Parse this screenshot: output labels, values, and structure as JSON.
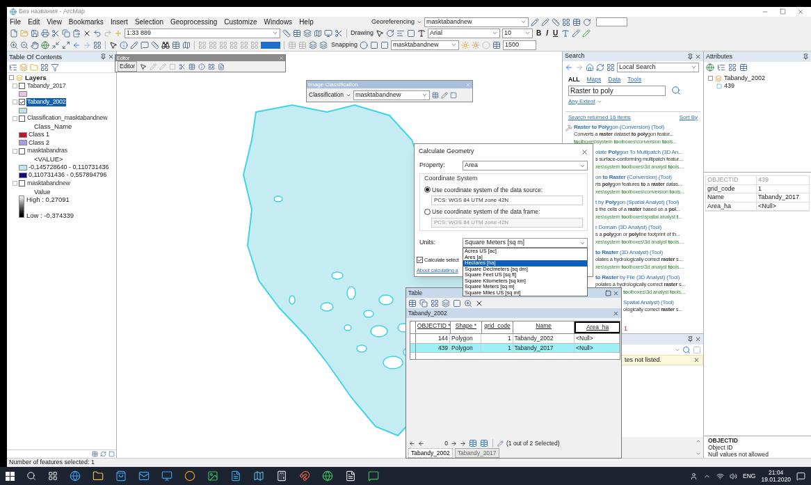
{
  "window": {
    "title": "Без названия - ArcMap"
  },
  "menu": [
    "File",
    "Edit",
    "View",
    "Bookmarks",
    "Insert",
    "Selection",
    "Geoprocessing",
    "Customize",
    "Windows",
    "Help"
  ],
  "toolbars": {
    "scale": "1:33 889",
    "drawing": "Drawing",
    "font": "Arial",
    "font_size": "10",
    "text_style": [
      "B",
      "I",
      "U"
    ],
    "georeferencing": "Georeferencing",
    "georef_layer": "masktabandnew",
    "snapping": "Snapping",
    "layer_combo": "masktabandnew",
    "reference_scale": "1500"
  },
  "editor_toolbar": {
    "title": "Editor",
    "menu": "Editor"
  },
  "image_classification": {
    "title": "Image Classification",
    "menu": "Classification",
    "layer": "masktabandnew"
  },
  "toc": {
    "title": "Table Of Contents",
    "root": "Layers",
    "layers": [
      {
        "name": "Tabandy_2017",
        "checked": false,
        "selected": false,
        "legend": [
          {
            "kind": "swatch",
            "color": "#e6c6ea"
          }
        ]
      },
      {
        "name": "Tabandy_2002",
        "checked": true,
        "selected": true,
        "legend": [
          {
            "kind": "swatch",
            "color": "#bfe2ea"
          }
        ]
      },
      {
        "name": "Classification_masktabandnew",
        "checked": false,
        "selected": false,
        "legend": [
          {
            "kind": "text",
            "label": "Class_Name"
          },
          {
            "kind": "swatch",
            "color": "#c0162c",
            "label": "Class 1"
          },
          {
            "kind": "swatch",
            "color": "#a89de6",
            "label": "Class 2"
          }
        ]
      },
      {
        "name": "masktabandras",
        "checked": false,
        "selected": false,
        "legend": [
          {
            "kind": "text",
            "label": "<VALUE>"
          },
          {
            "kind": "swatch",
            "color": "#c2e4ec",
            "label": "-0,145728640 - 0,110731436"
          },
          {
            "kind": "swatch",
            "color": "#0b0b80",
            "label": "0,110731436 - 0,557894796"
          }
        ]
      },
      {
        "name": "masktabandnew",
        "checked": false,
        "selected": false,
        "legend": [
          {
            "kind": "text",
            "label": "Value"
          },
          {
            "kind": "ramp",
            "high": "High : 0,27091",
            "low": "Low : -0,374339"
          }
        ]
      }
    ]
  },
  "dialog": {
    "title": "Calculate Geometry",
    "property_label": "Property:",
    "property": "Area",
    "group": "Coordinate System",
    "options": [
      {
        "label": "Use coordinate system of the data source:",
        "value": "PCS: WGS 84 UTM zone 42N",
        "selected": true
      },
      {
        "label": "Use coordinate system of the data frame:",
        "value": "PCS: WGS 84 UTM zone 42N",
        "selected": false
      }
    ],
    "units_label": "Units:",
    "units": "Square Meters [sq m]",
    "unit_options": [
      {
        "label": "Acres US [ac]",
        "selected": false
      },
      {
        "label": "Ares [a]",
        "selected": false
      },
      {
        "label": "Hectares [ha]",
        "selected": true
      },
      {
        "label": "Square Decimeters [sq dm]",
        "selected": false
      },
      {
        "label": "Square Feet US [sq ft]",
        "selected": false
      },
      {
        "label": "Square Kilometers [sq km]",
        "selected": false
      },
      {
        "label": "Square Meters [sq m]",
        "selected": false
      },
      {
        "label": "Square Miles US [sq mi]",
        "selected": false
      }
    ],
    "calc_selected": {
      "label": "Calculate select",
      "checked": true
    },
    "link": "About calculating a"
  },
  "table": {
    "title": "Table",
    "layer": "Tabandy_2002",
    "columns": [
      "OBJECTID *",
      "Shape *",
      "grid_code",
      "Name",
      "Area_ha"
    ],
    "rows": [
      {
        "cells": [
          "144",
          "Polygon",
          "1",
          "Tabandy_2002",
          "<Null>"
        ],
        "selected": false
      },
      {
        "cells": [
          "439",
          "Polygon",
          "1",
          "Tabandy_2017",
          "<Null>"
        ],
        "selected": true
      }
    ],
    "record": "0",
    "selection": "(1 out of 2 Selected)",
    "tabs": [
      {
        "label": "Tabandy_2002",
        "selected": true
      },
      {
        "label": "Tabandy_2017",
        "selected": false
      }
    ]
  },
  "search": {
    "title": "Search",
    "scope": "Local Search",
    "tabs": [
      {
        "label": "ALL",
        "selected": true
      },
      {
        "label": "Maps",
        "selected": false
      },
      {
        "label": "Data",
        "selected": false
      },
      {
        "label": "Tools",
        "selected": false
      }
    ],
    "query": "Raster to poly",
    "extent": "Any Extent",
    "summary": "Search returned 16 items",
    "sort": "Sort By",
    "results": [
      {
        "kind": "full",
        "title": "**Raster to Poly**gon (Conversion) (Tool)",
        "description": "Converts a **raster** dataset **to poly**gon featur...",
        "path": "**to**olboxes\\system **to**olboxes\\conversion **to**ols..."
      },
      {
        "kind": "clipped",
        "title": "olate **Poly**gon To Multipatch (3D An...",
        "description": "s surface-conforming multipatch featur...",
        "path": "xes\\system **to**olboxes\\3d analyst **to**ols...."
      },
      {
        "kind": "clipped",
        "title": "on **to Raster** (Conversion) (Tool)",
        "description": "rts **poly**gon features **to** a **raster** datas...",
        "path": "xes\\system **to**olboxes\\conversion **to**ols..."
      },
      {
        "kind": "clipped",
        "title": "t by **Poly**gon (Spatial Analyst) (Tool)",
        "description": "s the cells of a **raster** based on a **pol**...",
        "path": "xes\\system **to**olboxes\\spatial analyst **t**..."
      },
      {
        "kind": "clipped",
        "title": "r Domain (3D Analyst) (Tool)",
        "description": "s a **poly**gon or **poly**line footprint of th...",
        "path": "xes\\system **to**olboxes\\3d analyst **to**ols...."
      },
      {
        "kind": "clipped",
        "title": "**to Raster** (3D Analyst) (Tool)",
        "description": "olates a hydrologically correct **raster** s...",
        "path": "xes\\system **to**olboxes\\3d analyst **to**ols...."
      },
      {
        "kind": "clipped_low",
        "title": "**to Raster** by File (3D Analyst) (Tool)",
        "description": "polates a hydrologically correct **raster** s...",
        "path": "**to**olboxes\\3d analyst **to**ols...."
      },
      {
        "kind": "far",
        "title": "Spatial Analyst) (Tool)",
        "description": "ologically correct **raster** s..."
      }
    ],
    "page": "1"
  },
  "results_panel": {
    "message": "tes not listed."
  },
  "attributes": {
    "title": "Attributes",
    "layer": "Tabandy_2002",
    "feature": "439",
    "fields": [
      [
        "OBJECTID",
        "439"
      ],
      [
        "grid_code",
        "1"
      ],
      [
        "Name",
        "Tabandy_2017"
      ],
      [
        "Area_ha",
        "<Null>"
      ]
    ],
    "field_name": "OBJECTID",
    "field_alias": "Object ID",
    "field_note": "Null values not allowed"
  },
  "status_bar": "Number of features selected: 1",
  "taskbar": {
    "language": "ENG",
    "time": "21:04",
    "date": "19.01.2020"
  }
}
